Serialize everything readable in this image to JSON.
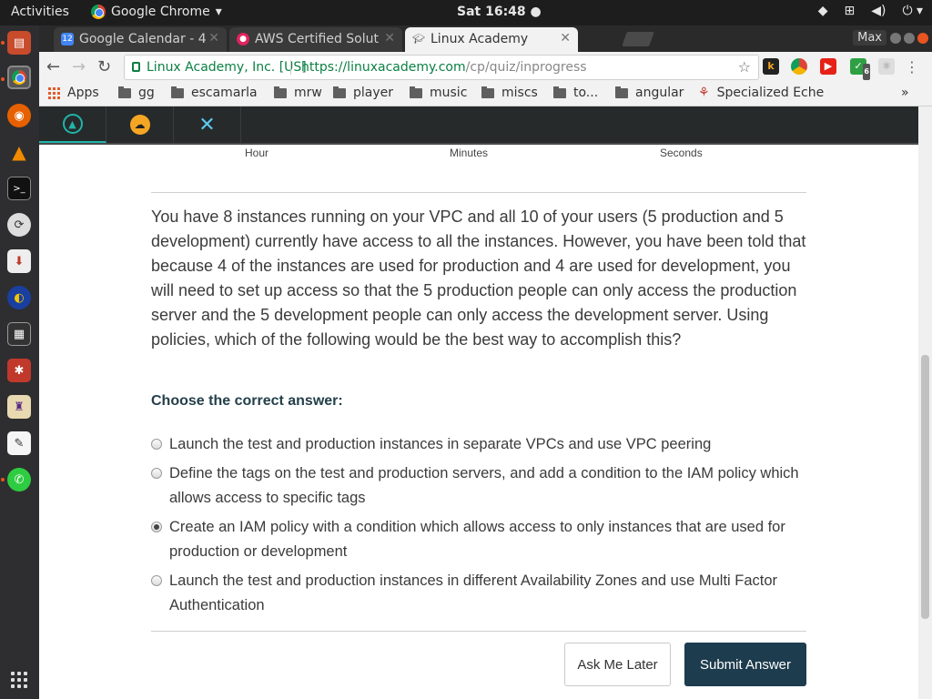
{
  "topbar": {
    "activities": "Activities",
    "app_name": "Google Chrome",
    "clock": "Sat 16:48"
  },
  "browser": {
    "tabs": [
      {
        "label": "Google Calendar - 4",
        "icon": "calendar-icon",
        "icon_text": "12"
      },
      {
        "label": "AWS Certified Solut",
        "icon": "aws-course-icon"
      },
      {
        "label": "Linux Academy",
        "icon": "graduation-cap-icon"
      }
    ],
    "max_label": "Max",
    "omnibox": {
      "site_identity": "Linux Academy, Inc. [US]",
      "url_host": "https://linuxacademy.com",
      "url_path": "/cp/quiz/inprogress"
    },
    "extension_badge": "6",
    "bookmarks": {
      "apps": "Apps",
      "items": [
        "gg",
        "escamarla",
        "mrw",
        "player",
        "music",
        "miscs",
        "to...",
        "angular",
        "Specialized Eche"
      ]
    }
  },
  "quiz": {
    "timer_labels": {
      "hour": "Hour",
      "minutes": "Minutes",
      "seconds": "Seconds"
    },
    "question": "You have 8 instances running on your VPC and all 10 of your users (5 production and 5 development) currently have access to all the instances. However, you have been told that because 4 of the instances are used for production and 4 are used for development, you will need to set up access so that the 5 production people can only access the production server and the 5 development people can only access the development server. Using policies, which of the following would be the best way to accomplish this?",
    "choose_label": "Choose the correct answer:",
    "options": [
      {
        "text": "Launch the test and production instances in separate VPCs and use VPC peering",
        "selected": false
      },
      {
        "text": "Define the tags on the test and production servers, and add a condition to the IAM policy which allows access to specific tags",
        "selected": false
      },
      {
        "text": "Create an IAM policy with a condition which allows access to only instances that are used for production or development",
        "selected": true
      },
      {
        "text": "Launch the test and production instances in different Availability Zones and use Multi Factor Authentication",
        "selected": false
      }
    ],
    "ask_later": "Ask Me Later",
    "submit": "Submit Answer"
  },
  "colors": {
    "accent_teal": "#1fb5a8",
    "submit_bg": "#1d3c4d",
    "heading": "#24404a",
    "secure_green": "#0b8043"
  }
}
